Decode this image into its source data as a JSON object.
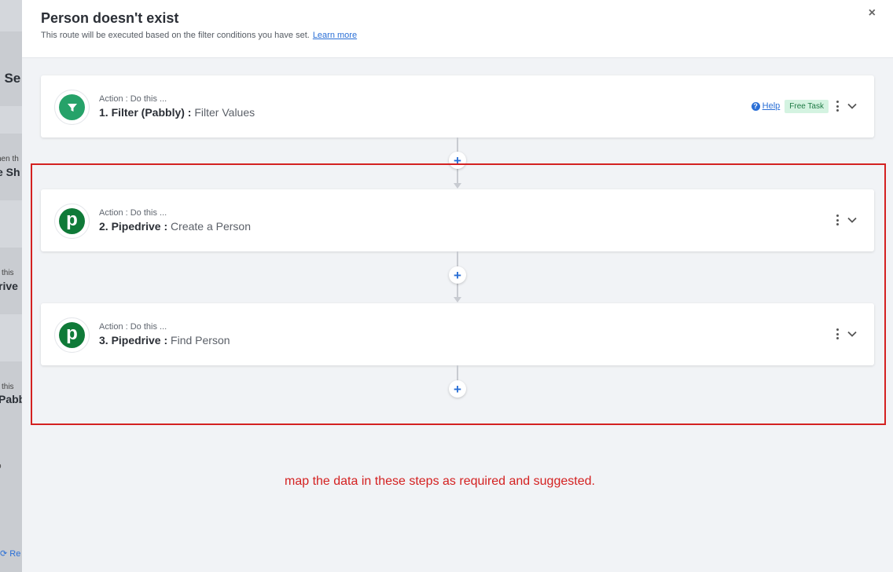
{
  "background": {
    "fragments": [
      "l Se",
      "hen th",
      "e Sh",
      "this",
      "rive",
      "this",
      "Pabb",
      "o",
      "Re"
    ]
  },
  "modal": {
    "title": "Person doesn't exist",
    "subtitle": "This route will be executed based on the filter conditions you have set.",
    "learn_more": "Learn more",
    "close_icon": "×"
  },
  "steps": [
    {
      "prefix": "Action : Do this ...",
      "app": "1. Filter (Pabbly) :",
      "action": "Filter Values",
      "logo": "filter-icon",
      "help": "Help",
      "badge": "Free Task"
    },
    {
      "prefix": "Action : Do this ...",
      "app": "2. Pipedrive :",
      "action": "Create a Person",
      "logo": "pipedrive-logo",
      "logo_letter": "p"
    },
    {
      "prefix": "Action : Do this ...",
      "app": "3. Pipedrive :",
      "action": "Find Person",
      "logo": "pipedrive-logo",
      "logo_letter": "p"
    }
  ],
  "connectors": {
    "plus_label": "+"
  },
  "annotation": {
    "note": "map the data in these steps as required and suggested.",
    "color": "#d42121"
  },
  "colors": {
    "accent": "#2a6fd6",
    "filter_green": "#26a269",
    "pipedrive_green": "#0f7a38"
  }
}
